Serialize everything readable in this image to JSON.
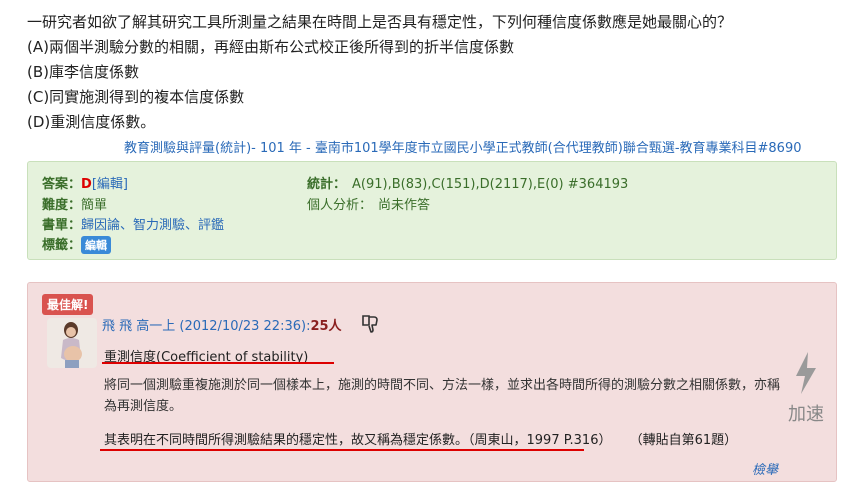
{
  "question": {
    "stem": "一研究者如欲了解其研究工具所測量之結果在時間上是否具有穩定性，下列何種信度係數應是她最關心的？",
    "options": [
      "(A)兩個半測驗分數的相關，再經由斯布公式校正後所得到的折半信度係數",
      "(B)庫李信度係數",
      "(C)同實施測得到的複本信度係數",
      "(D)重測信度係數。"
    ],
    "source": "教育測驗與評量(統計)- 101 年 - 臺南市101學年度市立國民小學正式教師(合代理教師)聯合甄選-教育專業科目#8690"
  },
  "info": {
    "answer_label": "答案：",
    "answer_value": "D",
    "edit_link": "[編輯]",
    "difficulty_label": "難度：",
    "difficulty_value": "簡單",
    "book_label": "書單：",
    "book_value": "歸因論、智力測驗、評鑑",
    "tag_label": "標籤：",
    "tag_badge": "編輯",
    "stats_label": "統計：",
    "stats_value": "A(91),B(83),C(151),D(2117),E(0) #364193",
    "personal_label": "個人分析：",
    "personal_value": "尚未作答"
  },
  "best_answer": {
    "badge": "最佳解!",
    "author": "飛 飛 高一上",
    "date": "(2012/10/23 22:36):",
    "likes": "25人",
    "title": "重測信度(Coefficient of stability)",
    "paragraph1": "將同一個測驗重複施測於同一個樣本上，施測的時間不同、方法一樣，並求出各時間所得的測驗分數之相關係數，亦稱為再測信度。",
    "paragraph2_main": "其表明在不同時間所得測驗結果的穩定性，故又稱為穩定係數。（周東山，1997 P.316）",
    "paragraph2_note": "（轉貼自第61題）",
    "report": "檢舉"
  },
  "accelerate": {
    "label": "加速"
  },
  "colors": {
    "link": "#2a6ab8",
    "info_bg": "#e5f2dc",
    "best_bg": "#f3dede",
    "accent_red": "#d00000"
  },
  "icons": [
    "thumbs-down-icon",
    "lightning-icon",
    "avatar-image"
  ]
}
